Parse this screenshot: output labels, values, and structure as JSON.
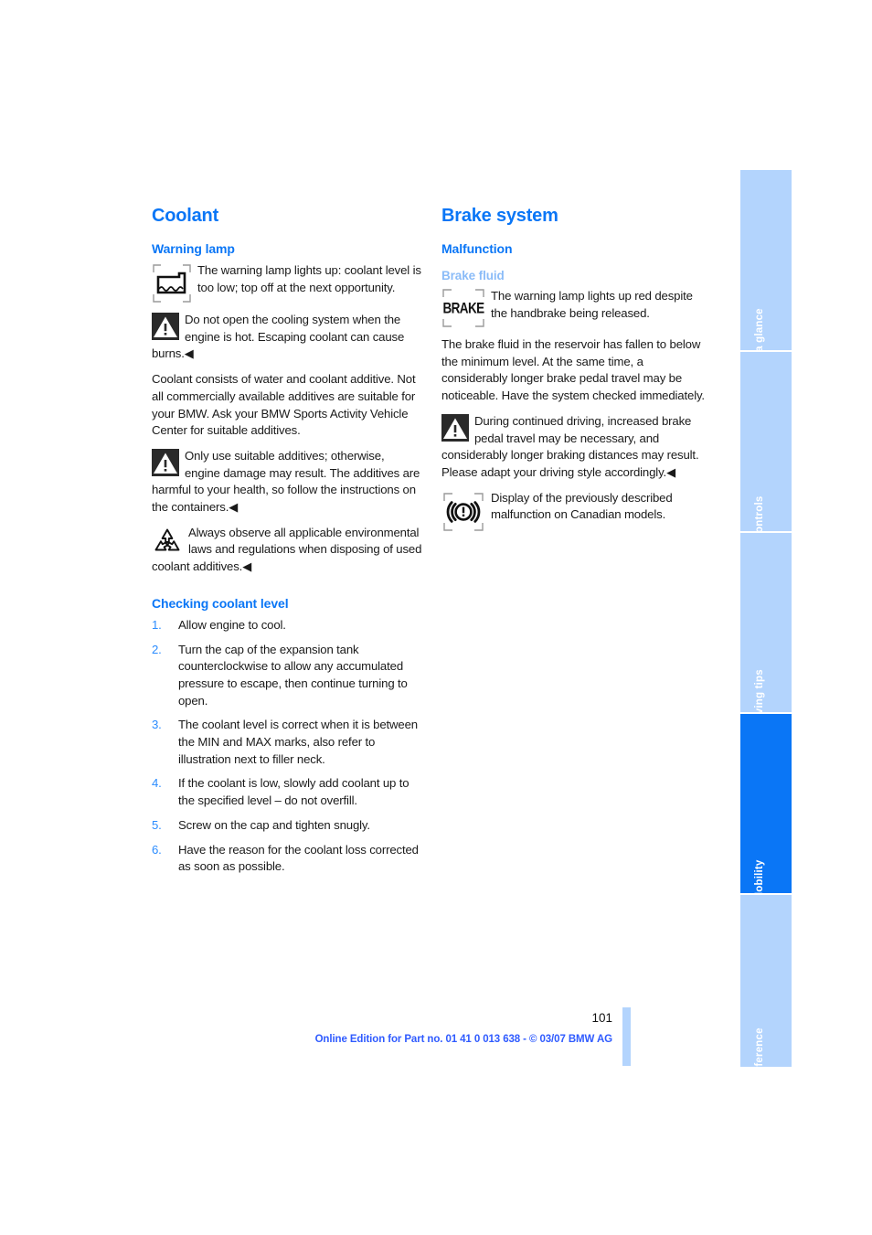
{
  "document": {
    "page_number": "101",
    "online_edition": "Online Edition for Part no. 01 41 0 013 638 - © 03/07 BMW AG"
  },
  "colors": {
    "heading_blue": "#0a76f6",
    "subheading_blue": "#8bbcf8",
    "list_number_blue": "#2b8cff",
    "tab_inactive": "#b3d4fd",
    "tab_active": "#0a76f6",
    "footer_blue": "#2f5bff",
    "body_text": "#1a1a1a"
  },
  "sidebar": {
    "tabs": [
      {
        "label": "At a glance",
        "active": false
      },
      {
        "label": "Controls",
        "active": false
      },
      {
        "label": "Driving tips",
        "active": false
      },
      {
        "label": "Mobility",
        "active": true
      },
      {
        "label": "Reference",
        "active": false
      }
    ]
  },
  "left_column": {
    "title": "Coolant",
    "warning_lamp": {
      "heading": "Warning lamp",
      "lamp_note": {
        "icon": "coolant-level-lamp-icon",
        "text": "The warning lamp lights up: coolant level is too low; top off at the next opportunity."
      },
      "caution_1": {
        "icon": "warning-triangle-icon",
        "text": "Do not open the cooling system when the engine is hot. Escaping coolant can cause burns.",
        "endmark": "◀"
      },
      "paragraph": "Coolant consists of water and coolant additive. Not all commercially available additives are suitable for your BMW. Ask your BMW Sports Activity Vehicle Center for suitable additives.",
      "caution_2": {
        "icon": "warning-triangle-icon",
        "text": "Only use suitable additives; otherwise, engine damage may result. The additives are harmful to your health, so follow the instructions on the containers.",
        "endmark": "◀"
      },
      "environment_note": {
        "icon": "recycling-icon",
        "text": "Always observe all applicable environmental laws and regulations when disposing of used coolant additives.",
        "endmark": "◀"
      }
    },
    "checking_coolant_level": {
      "heading": "Checking coolant level",
      "steps": [
        {
          "num": "1.",
          "text": "Allow engine to cool."
        },
        {
          "num": "2.",
          "text": "Turn the cap of the expansion tank counterclockwise to allow any accumulated pressure to escape, then continue turning to open."
        },
        {
          "num": "3.",
          "text": "The coolant level is correct when it is between the MIN and MAX marks, also refer to illustration next to filler neck."
        },
        {
          "num": "4.",
          "text": "If the coolant is low, slowly add coolant up to the specified level – do not overfill."
        },
        {
          "num": "5.",
          "text": "Screw on the cap and tighten snugly."
        },
        {
          "num": "6.",
          "text": "Have the reason for the coolant loss corrected as soon as possible."
        }
      ]
    }
  },
  "right_column": {
    "title": "Brake system",
    "malfunction": {
      "heading": "Malfunction",
      "brake_fluid": {
        "heading": "Brake fluid",
        "lamp_note": {
          "icon": "brake-text-lamp-icon",
          "icon_text": "BRAKE",
          "text": "The warning lamp lights up red despite the handbrake being released."
        },
        "paragraph": "The brake fluid in the reservoir has fallen to below the minimum level. At the same time, a considerably longer brake pedal travel may be noticeable. Have the system checked immediately.",
        "caution": {
          "icon": "warning-triangle-icon",
          "text": "During continued driving, increased brake pedal travel may be necessary, and considerably longer braking distances may result. Please adapt your driving style accordingly.",
          "endmark": "◀"
        },
        "canadian_note": {
          "icon": "brake-circle-lamp-icon",
          "text": "Display of the previously described malfunction on Canadian models."
        }
      }
    }
  }
}
